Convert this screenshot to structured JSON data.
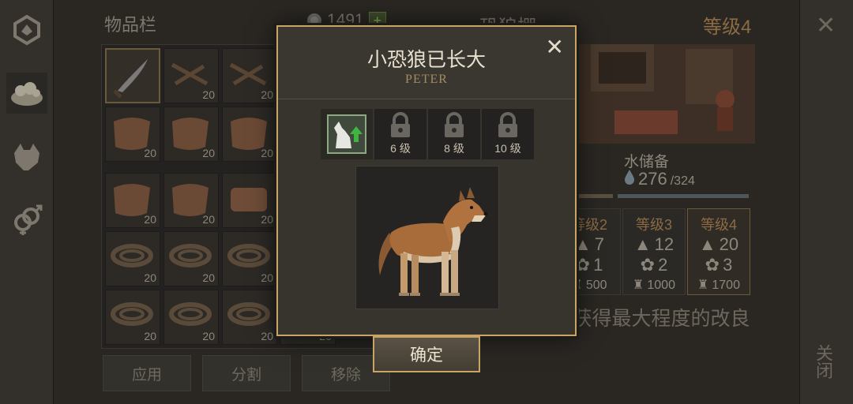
{
  "sidebar": {
    "items": [
      {
        "name": "crafting-icon"
      },
      {
        "name": "food-icon"
      },
      {
        "name": "wolf-icon"
      },
      {
        "name": "gender-icon"
      }
    ]
  },
  "inventory": {
    "title": "物品栏",
    "coins": "1491",
    "plus": "+",
    "quantities": [
      "20",
      "20",
      "20",
      "20",
      "20",
      "20",
      "20",
      "20",
      "20",
      "20",
      "20",
      "20",
      "20",
      "20",
      "20",
      "20",
      "20",
      "20"
    ],
    "buttons": {
      "apply": "应用",
      "split": "分割",
      "remove": "移除"
    }
  },
  "den": {
    "title": "恐狼棚",
    "level": "等级4",
    "water_label": "水储备",
    "water_value": "276",
    "water_max": "/324",
    "levels": [
      {
        "label": "等级2",
        "a": "7",
        "b": "1",
        "c": "500"
      },
      {
        "label": "等级3",
        "a": "12",
        "b": "2",
        "c": "1000"
      },
      {
        "label": "等级4",
        "a": "20",
        "b": "3",
        "c": "1700"
      }
    ],
    "max_text": "恐狼棚已获得最大程度的改良"
  },
  "close": {
    "x": "✕",
    "label": "关闭"
  },
  "modal": {
    "title": "小恐狼已长大",
    "subtitle": "PETER",
    "close": "✕",
    "skills": [
      {
        "label": ""
      },
      {
        "label": "6 级"
      },
      {
        "label": "8 级"
      },
      {
        "label": "10 级"
      }
    ],
    "confirm": "确定"
  }
}
